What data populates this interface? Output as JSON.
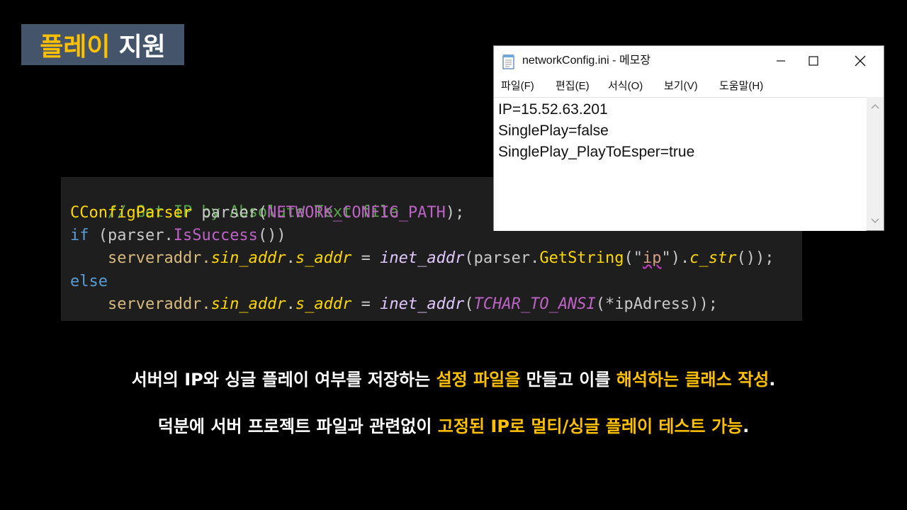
{
  "title": {
    "highlight": "플레이",
    "rest": "지원"
  },
  "code": {
    "line1": "// Get IP by Absolute Text file",
    "line2": {
      "type": "CConfigParser",
      "var": " parser(",
      "macro": "NETWORK_CONFIG_PATH",
      "end": ");"
    },
    "line3": {
      "kw": "if",
      "a": " (parser.",
      "fn": "IsSuccess",
      "b": "())"
    },
    "line4": {
      "indent": "    serveraddr.",
      "m1": "sin_addr",
      "dot": ".",
      "m2": "s_addr",
      "eq": " = ",
      "f1": "inet_addr",
      "p": "(parser.",
      "f2": "GetString",
      "q1": "(\"",
      "s": "ip",
      "q2": "\").",
      "f3": "c_str",
      "end": "());"
    },
    "line5": "else",
    "line6": {
      "indent": "    serveraddr.",
      "m1": "sin_addr",
      "dot": ".",
      "m2": "s_addr",
      "eq": " = ",
      "f1": "inet_addr",
      "p": "(",
      "mac": "TCHAR_TO_ANSI",
      "end": "(*ipAdress));"
    }
  },
  "notepad": {
    "title": "networkConfig.ini - 메모장",
    "menu": [
      "파일(F)",
      "편집(E)",
      "서식(O)",
      "보기(V)",
      "도움말(H)"
    ],
    "lines": [
      "IP=15.52.63.201",
      "SinglePlay=false",
      "SinglePlay_PlayToEsper=true"
    ],
    "icons": {
      "file": "notepad-file-icon",
      "minimize": "minimize-icon",
      "maximize": "maximize-icon",
      "close": "close-icon"
    }
  },
  "caption1": {
    "a": "서버의 IP와 싱글 플레이 여부를 저장하는 ",
    "hl1": "설정 파일을",
    "b": " 만들고 이를 ",
    "hl2": "해석하는 클래스 작성",
    "c": "."
  },
  "caption2": {
    "a": "덕분에 서버 프로젝트 파일과 관련없이 ",
    "hl": "고정된 IP로 멀티/싱글 플레이 테스트 가능",
    "c": "."
  },
  "colors": {
    "highlight": "#ffc000",
    "badge": "#44546a",
    "code_bg": "#1e1e1e",
    "comment": "#57a64a"
  }
}
